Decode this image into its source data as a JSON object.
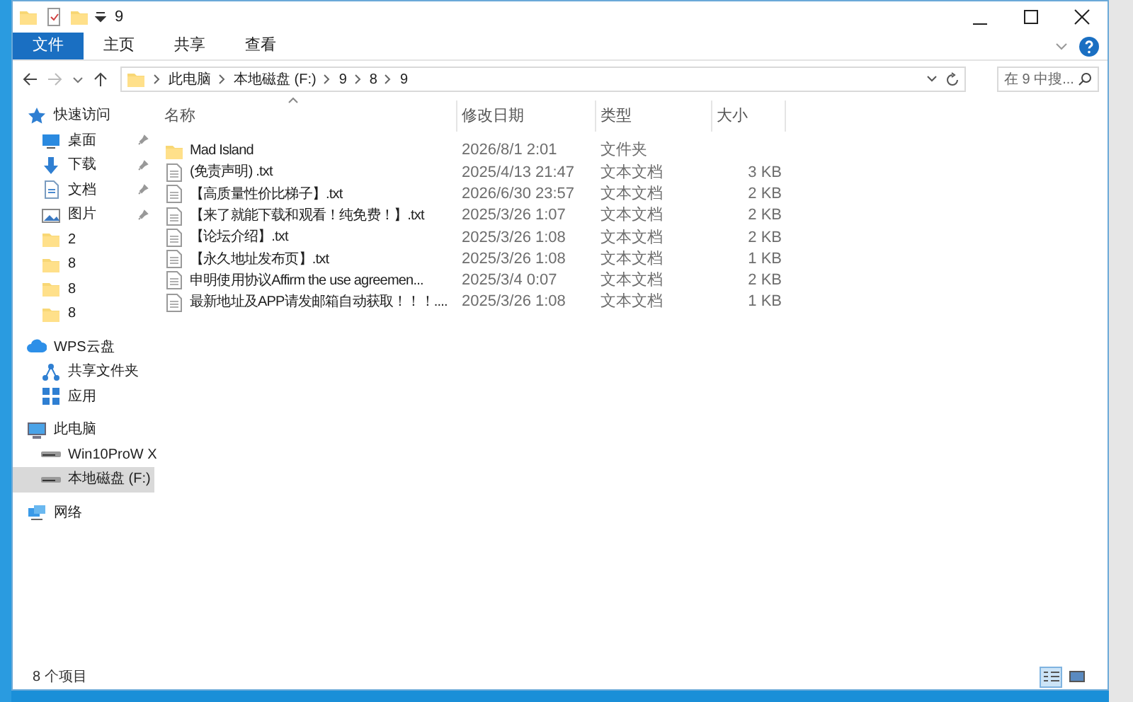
{
  "window": {
    "title": "9"
  },
  "ribbon_tabs": [
    {
      "label": "文件",
      "kind": "file"
    },
    {
      "label": "主页",
      "kind": "tab"
    },
    {
      "label": "共享",
      "kind": "tab"
    },
    {
      "label": "查看",
      "kind": "tab"
    }
  ],
  "address": {
    "path": [
      "此电脑",
      "本地磁盘 (F:)",
      "9",
      "8",
      "9"
    ]
  },
  "search": {
    "placeholder": "在 9 中搜..."
  },
  "sidebar": {
    "items": [
      {
        "label": "快速访问",
        "kind": "star",
        "selected": false,
        "children": [
          {
            "label": "桌面",
            "kind": "desktop",
            "pinned": true,
            "selected": false
          },
          {
            "label": "下载",
            "kind": "download",
            "pinned": true,
            "selected": false
          },
          {
            "label": "文档",
            "kind": "document",
            "pinned": true,
            "selected": false
          },
          {
            "label": "图片",
            "kind": "pictures",
            "pinned": true,
            "selected": false
          },
          {
            "label": "2",
            "kind": "folder",
            "pinned": false,
            "selected": false
          },
          {
            "label": "8",
            "kind": "folder",
            "pinned": false,
            "selected": false
          },
          {
            "label": "8",
            "kind": "folder",
            "pinned": false,
            "selected": false
          },
          {
            "label": "8",
            "kind": "folder",
            "pinned": false,
            "selected": false
          }
        ]
      },
      {
        "label": "WPS云盘",
        "kind": "cloud",
        "selected": false,
        "children": [
          {
            "label": "共享文件夹",
            "kind": "share",
            "pinned": false,
            "selected": false
          },
          {
            "label": "应用",
            "kind": "apps",
            "pinned": false,
            "selected": false
          }
        ]
      },
      {
        "label": "此电脑",
        "kind": "pc",
        "selected": false,
        "children": [
          {
            "label": "Win10ProW X",
            "kind": "drive",
            "pinned": false,
            "selected": false
          },
          {
            "label": "本地磁盘 (F:)",
            "kind": "drive",
            "pinned": false,
            "selected": true
          }
        ]
      },
      {
        "label": "网络",
        "kind": "network",
        "selected": false
      }
    ]
  },
  "table": {
    "columns": [
      {
        "label": "名称",
        "sorted": true
      },
      {
        "label": "修改日期",
        "sorted": false
      },
      {
        "label": "类型",
        "sorted": false
      },
      {
        "label": "大小",
        "sorted": false
      }
    ],
    "rows": [
      {
        "kind": "folder",
        "name": "Mad Island",
        "date": "2026/8/1 2:01",
        "type": "文件夹"
      },
      {
        "kind": "text",
        "name": "(免责声明) .txt",
        "date": "2025/4/13 21:47",
        "type": "文本文档",
        "size": "3 KB"
      },
      {
        "kind": "text",
        "name": "【高质量性价比梯子】.txt",
        "date": "2026/6/30 23:57",
        "type": "文本文档",
        "size": "2 KB"
      },
      {
        "kind": "text",
        "name": "【来了就能下载和观看！纯免费！】.txt",
        "date": "2025/3/26 1:07",
        "type": "文本文档",
        "size": "2 KB"
      },
      {
        "kind": "text",
        "name": "【论坛介绍】.txt",
        "date": "2025/3/26 1:08",
        "type": "文本文档",
        "size": "2 KB"
      },
      {
        "kind": "text",
        "name": "【永久地址发布页】.txt",
        "date": "2025/3/26 1:08",
        "type": "文本文档",
        "size": "1 KB"
      },
      {
        "kind": "text",
        "name": "申明使用协议Affirm the use agreemen...",
        "date": "2025/3/4 0:07",
        "type": "文本文档",
        "size": "2 KB"
      },
      {
        "kind": "text",
        "name": "最新地址及APP请发邮箱自动获取！！！....",
        "date": "2025/3/26 1:08",
        "type": "文本文档",
        "size": "1 KB"
      }
    ]
  },
  "status_bar": {
    "text": "8 个项目",
    "views": [
      {
        "kind": "details",
        "selected": true
      },
      {
        "kind": "large_icons",
        "selected": false
      }
    ]
  }
}
